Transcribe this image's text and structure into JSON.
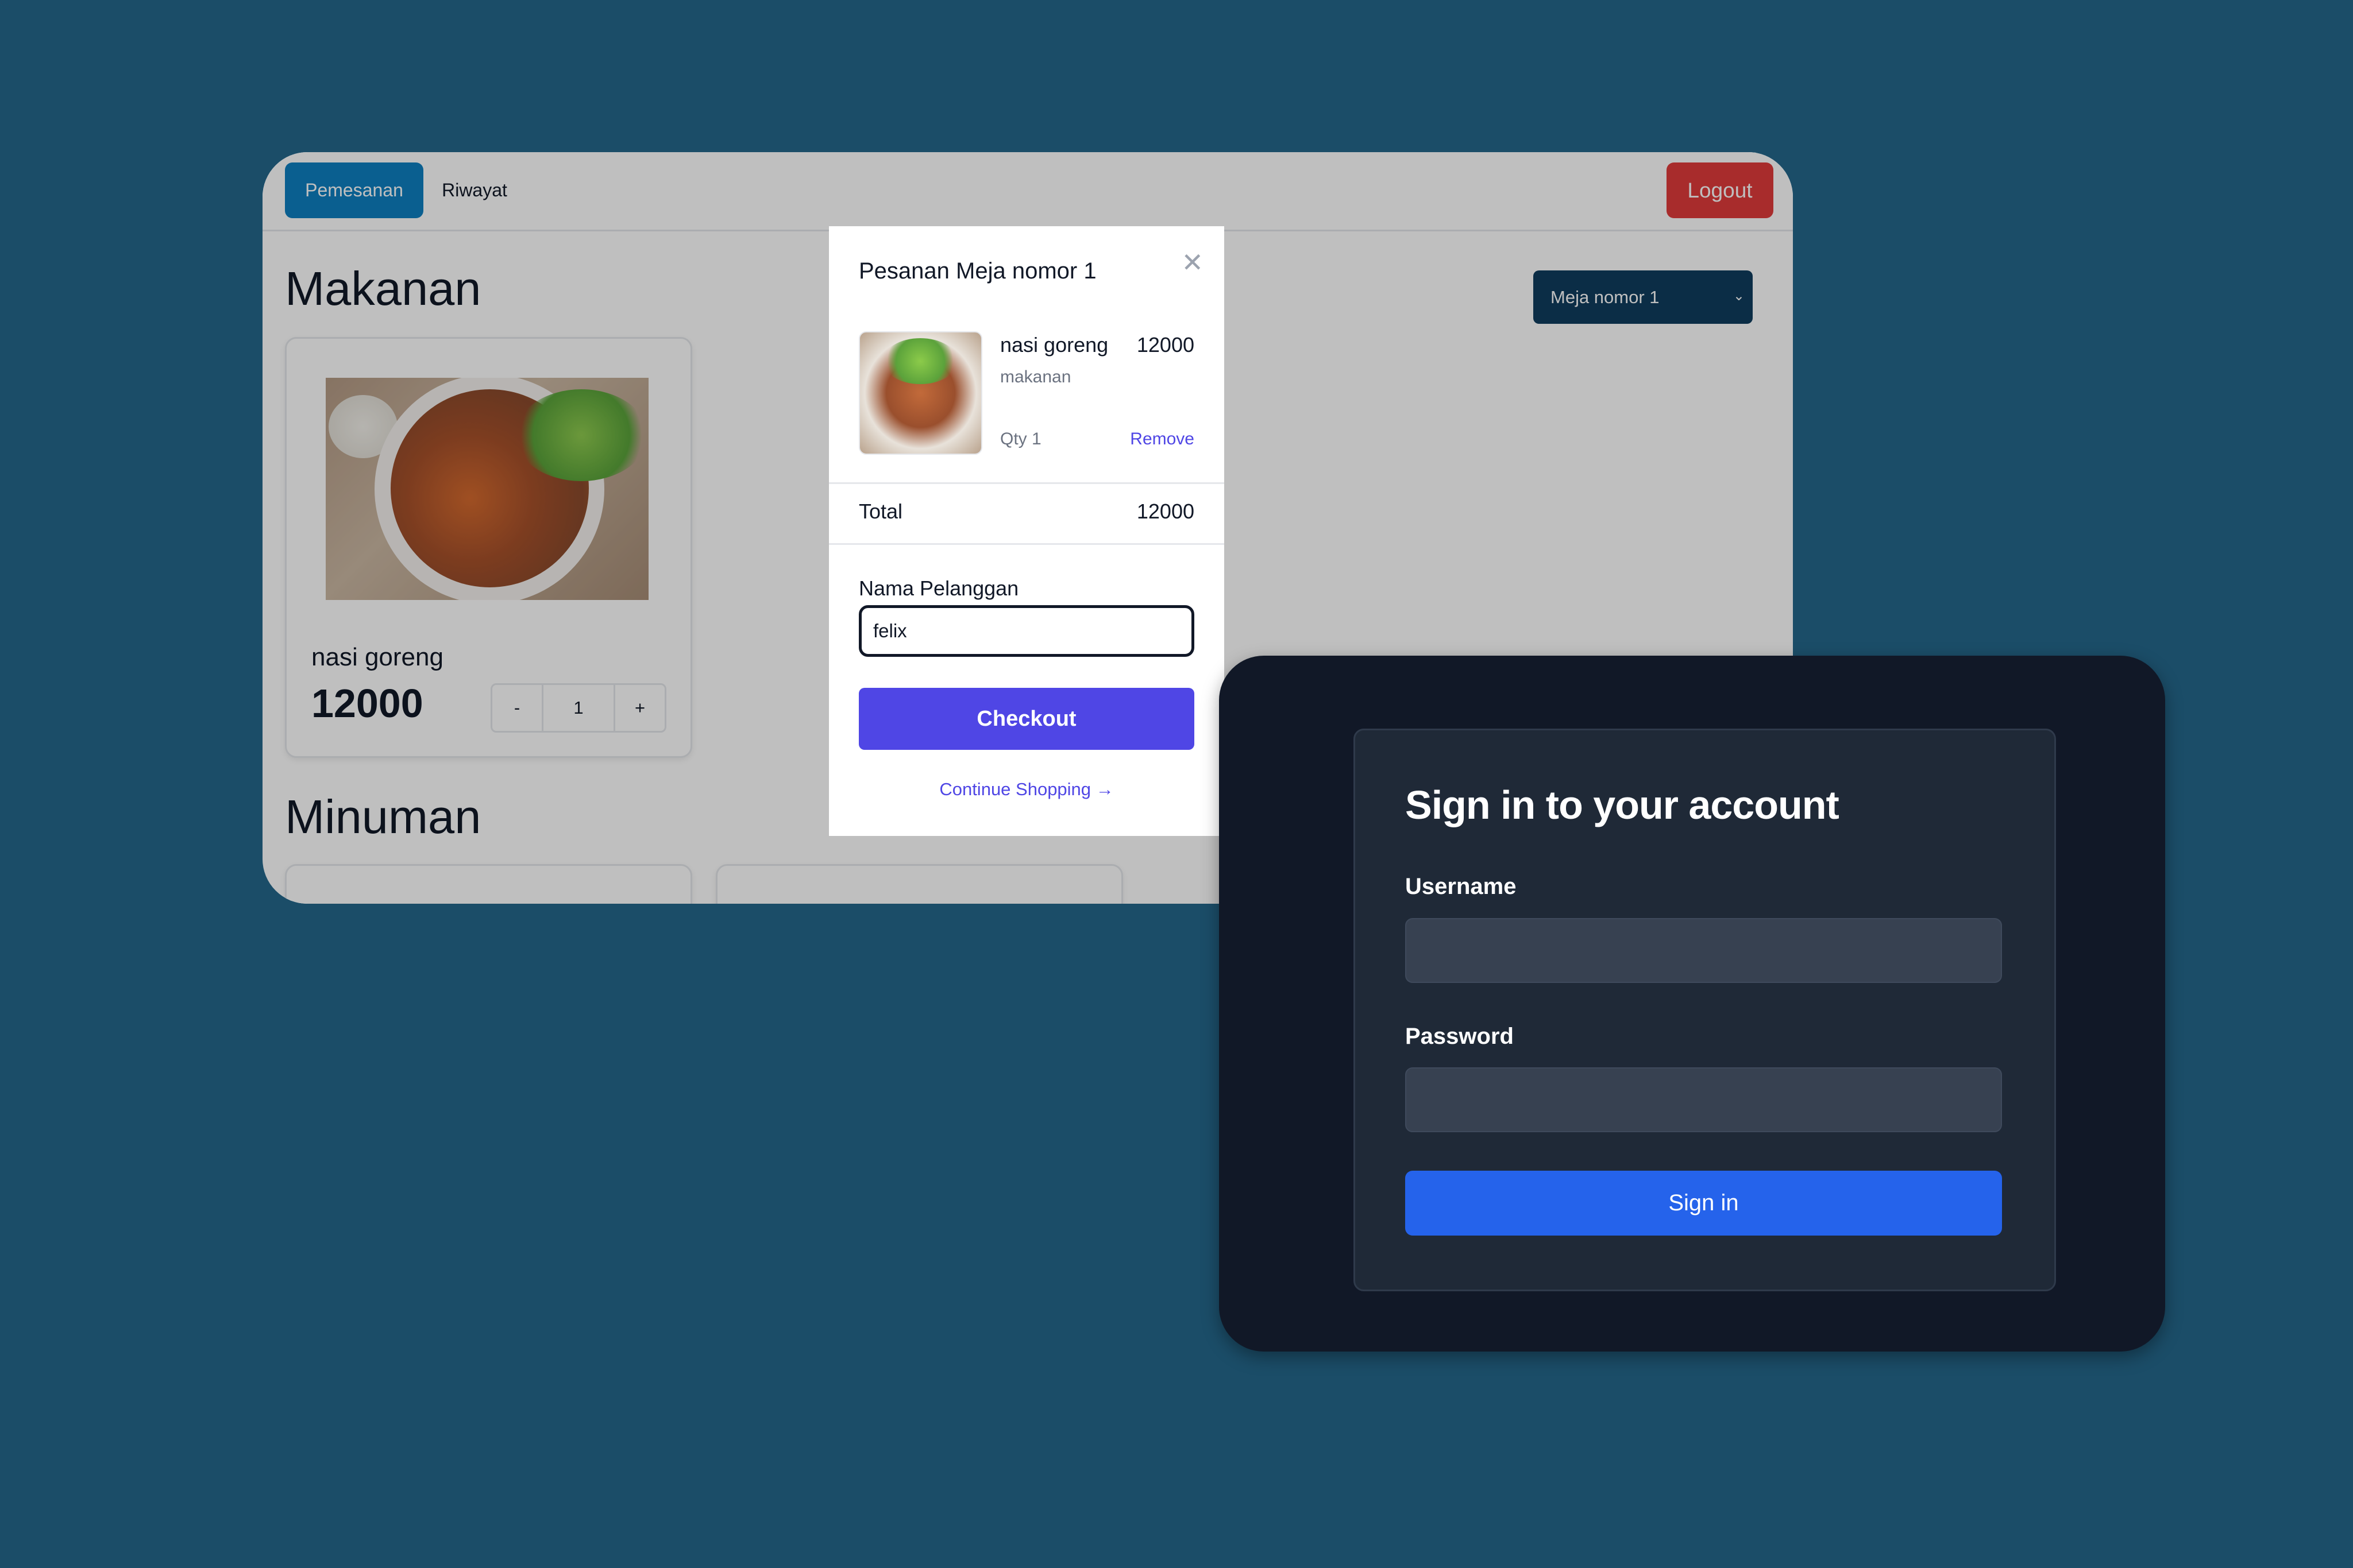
{
  "nav": {
    "tabs": [
      {
        "label": "Pemesanan",
        "active": true
      },
      {
        "label": "Riwayat",
        "active": false
      }
    ],
    "logout_label": "Logout"
  },
  "table_select": {
    "selected": "Meja nomor 1",
    "icon": "chevron-down-icon"
  },
  "sections": {
    "food_title": "Makanan",
    "drink_title": "Minuman"
  },
  "menu_item": {
    "name": "nasi goreng",
    "price": "12000",
    "qty": "1",
    "minus_label": "-",
    "plus_label": "+"
  },
  "modal": {
    "title": "Pesanan Meja nomor 1",
    "item": {
      "name": "nasi goreng",
      "price": "12000",
      "category": "makanan",
      "qty_text": "Qty 1",
      "remove_label": "Remove"
    },
    "total_label": "Total",
    "total_value": "12000",
    "customer_label": "Nama Pelanggan",
    "customer_value": "felix",
    "checkout_label": "Checkout",
    "continue_label": "Continue Shopping →"
  },
  "signin": {
    "title": "Sign in to your account",
    "username_label": "Username",
    "password_label": "Password",
    "button_label": "Sign in"
  },
  "colors": {
    "background": "#1b4d68",
    "primary_tab": "#0e7fc0",
    "logout": "#e13b3b",
    "checkout": "#4f46e5",
    "signin_button": "#2563eb",
    "signin_bg": "#111827"
  }
}
